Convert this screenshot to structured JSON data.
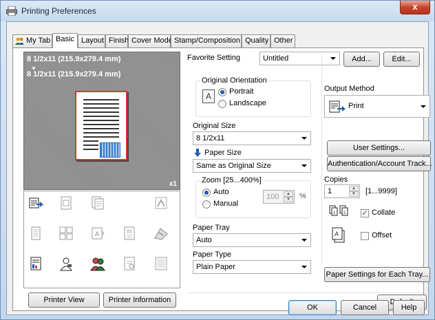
{
  "window": {
    "title": "Printing Preferences",
    "close_label": "x"
  },
  "tabs": [
    {
      "label": "My Tab"
    },
    {
      "label": "Basic"
    },
    {
      "label": "Layout"
    },
    {
      "label": "Finish"
    },
    {
      "label": "Cover Mode"
    },
    {
      "label": "Stamp/Composition"
    },
    {
      "label": "Quality"
    },
    {
      "label": "Other"
    }
  ],
  "active_tab": "Basic",
  "preview": {
    "line1": "8 1/2x11 (215.9x279.4 mm)",
    "line2": "8 1/2x11 (215.9x279.4 mm)",
    "copies_badge": "x1"
  },
  "favorite": {
    "label": "Favorite Setting",
    "value": "Untitled",
    "add_label": "Add...",
    "edit_label": "Edit..."
  },
  "orientation": {
    "title": "Original Orientation",
    "portrait": "Portrait",
    "landscape": "Landscape",
    "selected": "Portrait"
  },
  "original_size": {
    "label": "Original Size",
    "value": "8 1/2x11"
  },
  "paper_size": {
    "label": "Paper Size",
    "value": "Same as Original Size"
  },
  "zoom": {
    "title": "Zoom [25...400%]",
    "auto": "Auto",
    "manual": "Manual",
    "selected": "Auto",
    "value": "100",
    "unit": "%"
  },
  "paper_tray": {
    "label": "Paper Tray",
    "value": "Auto"
  },
  "paper_type": {
    "label": "Paper Type",
    "value": "Plain Paper"
  },
  "output": {
    "label": "Output Method",
    "value": "Print"
  },
  "user_settings_label": "User Settings...",
  "auth_label": "Authentication/Account Track...",
  "copies": {
    "label": "Copies",
    "value": "1",
    "range": "[1...9999]"
  },
  "collate": {
    "label": "Collate",
    "checked": true
  },
  "offset": {
    "label": "Offset",
    "checked": false
  },
  "paper_settings_label": "Paper Settings for Each Tray...",
  "left_buttons": {
    "printer_view": "Printer View",
    "printer_info": "Printer Information"
  },
  "default_label": "Default",
  "footer": {
    "ok": "OK",
    "cancel": "Cancel",
    "help": "Help"
  },
  "colors": {
    "accent": "#1e5fb0",
    "close": "#c7442b"
  }
}
